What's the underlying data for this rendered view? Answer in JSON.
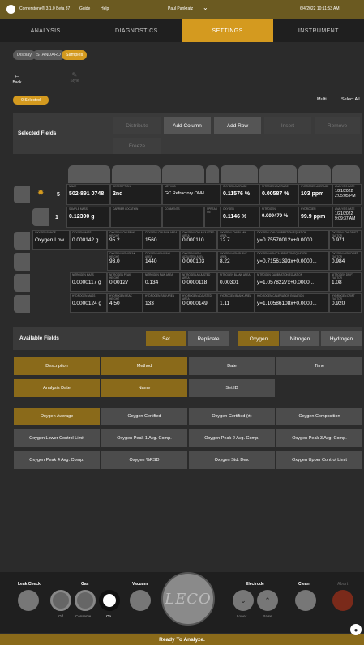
{
  "topbar": {
    "app": "Cornerstone® 3.1.0 Beta 37",
    "guide": "Guide",
    "help": "Help",
    "user": "Paul Pankratz",
    "datetime": "6/4/2022 10:11:53 AM"
  },
  "tabs": [
    "ANALYSIS",
    "DIAGNOSTICS",
    "SETTINGS",
    "INSTRUMENT"
  ],
  "breadcrumb": [
    "Display",
    "STANDARD",
    "Samples"
  ],
  "toolbar": {
    "back": "Back",
    "style": "Style",
    "selected": "0 Selected",
    "multi": "Multi",
    "select_all": "Select All"
  },
  "selected_fields": {
    "title": "Selected Fields",
    "buttons": [
      "Distribute",
      "Add Column",
      "Add Row",
      "Insert",
      "Remove",
      "Freeze"
    ]
  },
  "rows": [
    {
      "num": "5",
      "cells": [
        {
          "label": "NAME",
          "value": "502-891 0748"
        },
        {
          "label": "DESCRIPTION",
          "value": "2nd"
        },
        {
          "label": "METHOD",
          "value": "GC Refractory ONH"
        },
        {
          "label": "OXYGEN AVERAGE",
          "value": "0.11576 %"
        },
        {
          "label": "NITROGEN AVERAGE",
          "value": "0.00587 %"
        },
        {
          "label": "HYDROGEN AVERAGE",
          "value": "103 ppm"
        },
        {
          "label": "ANALYSIS DATE",
          "value": "1/21/2022 2:05:05 PM"
        }
      ]
    },
    {
      "num": "1",
      "cells": [
        {
          "label": "SAMPLE MASS",
          "value": "0.12390 g"
        },
        {
          "label": "CARRIER LOCATION",
          "value": ""
        },
        {
          "label": "COMMENTS",
          "value": ""
        },
        {
          "label": "SPREAD SN",
          "value": ""
        },
        {
          "label": "OXYGEN",
          "value": "0.1146 %"
        },
        {
          "label": "NITROGEN",
          "value": "0.009479 %"
        },
        {
          "label": "HYDROGEN",
          "value": "99.9 ppm"
        },
        {
          "label": "ANALYSIS DATE",
          "value": "1/21/2022 9:09:37 AM"
        }
      ]
    },
    {
      "cells": [
        {
          "label": "OXYGEN RANGE",
          "value": "Oxygen Low"
        },
        {
          "label": "OXYGEN MASS",
          "value": "0.000142 g"
        },
        {
          "label": "OXYGEN LOW PEAK HEIGHT",
          "value": "95.2"
        },
        {
          "label": "OXYGEN LOW RAW AREA",
          "value": "1560"
        },
        {
          "label": "OXYGEN LOW ADJUSTED AREA",
          "value": "0.000110"
        },
        {
          "label": "OXYGEN LOW BLANK AREA",
          "value": "12.7"
        },
        {
          "label": "OXYGEN LOW CALIBRATION EQUATION",
          "value": "y=0.75570012x+0.0000..."
        },
        {
          "label": "OXYGEN LOW DRIFT FACTOR",
          "value": "0.971"
        }
      ]
    },
    {
      "cells": [
        {
          "label": "OXYGEN HIGH PEAK HEIGHT",
          "value": "93.0"
        },
        {
          "label": "OXYGEN HIGH RAW AREA",
          "value": "1440"
        },
        {
          "label": "OXYGEN HIGH ADJUSTED AREA",
          "value": "0.000103"
        },
        {
          "label": "OXYGEN HIGH BLANK AREA",
          "value": "8.22"
        },
        {
          "label": "OXYGEN HIGH CALIBRATION EQUATION",
          "value": "y=0.71561393x+0.0000..."
        },
        {
          "label": "OXYGEN HIGH DRIFT FACTOR",
          "value": "0.984"
        }
      ]
    },
    {
      "cells": [
        {
          "label": "NITROGEN MASS",
          "value": "0.0000117 g"
        },
        {
          "label": "NITROGEN PEAK HEIGHT",
          "value": "0.00127"
        },
        {
          "label": "NITROGEN RAW AREA",
          "value": "0.134"
        },
        {
          "label": "NITROGEN ADJUSTED AREA",
          "value": "0.0000118"
        },
        {
          "label": "NITROGEN BLANK AREA",
          "value": "0.00301"
        },
        {
          "label": "NITROGEN CALIBRATION EQUATION",
          "value": "y=1.0578227x+0.0000..."
        },
        {
          "label": "NITROGEN DRIFT FACTOR",
          "value": "1.08"
        }
      ]
    },
    {
      "cells": [
        {
          "label": "HYDROGEN MASS",
          "value": "0.0000124 g"
        },
        {
          "label": "HYDROGEN PEAK HEIGHT",
          "value": "4.50"
        },
        {
          "label": "HYDROGEN RAW AREA",
          "value": "133"
        },
        {
          "label": "HYDROGEN ADJUSTED AREA",
          "value": "0.0000149"
        },
        {
          "label": "HYDROGEN BLANK AREA",
          "value": "1.11"
        },
        {
          "label": "HYDROGEN CALIBRATION EQUATION",
          "value": "y=1.10586108x+0.0000..."
        },
        {
          "label": "HYDROGEN DRIFT FACTOR",
          "value": "0.920"
        }
      ]
    }
  ],
  "available_fields": {
    "title": "Available Fields",
    "set": "Set",
    "replicate": "Replicate",
    "elements": [
      "Oxygen",
      "Nitrogen",
      "Hydrogen"
    ],
    "fields": [
      "Description",
      "Method",
      "Date",
      "Time",
      "Analysis Date",
      "Name",
      "Set ID",
      "Oxygen Average",
      "Oxygen Certified",
      "Oxygen Certified (±)",
      "Oxygen Composition",
      "Oxygen Lower Control Limit",
      "Oxygen Peak 1 Avg. Comp.",
      "Oxygen Peak 2 Avg. Comp.",
      "Oxygen Peak 3 Avg. Comp.",
      "Oxygen Peak 4 Avg. Comp.",
      "Oxygen %RSD",
      "Oxygen Std. Dev.",
      "Oxygen Upper Control Limit"
    ]
  },
  "controls": {
    "leak_check": "Leak Check",
    "gas": "Gas",
    "vacuum": "Vacuum",
    "logo": "LECO",
    "electrode": "Electrode",
    "clean": "Clean",
    "abort": "Abort",
    "off": "Off",
    "conserve": "Conserve",
    "on": "On",
    "lower": "Lower",
    "raise": "Raise"
  },
  "status": "Ready To Analyze.",
  "colors": {
    "accent": "#d49a1f",
    "field_gold": "#8a6a1a"
  }
}
